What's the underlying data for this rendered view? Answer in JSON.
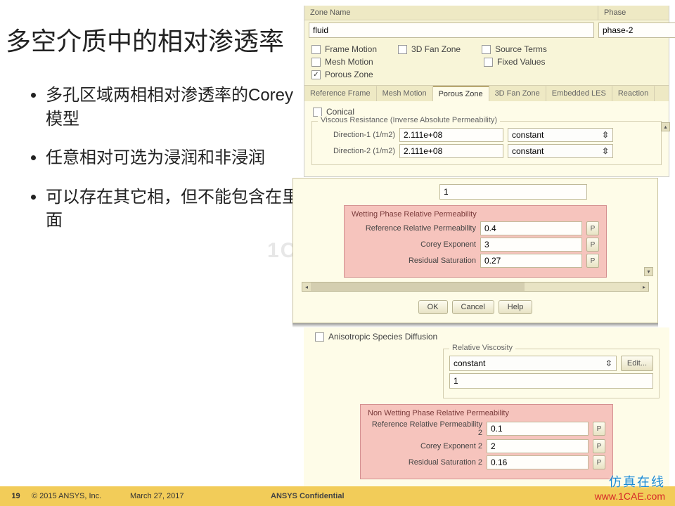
{
  "slide": {
    "title": "多空介质中的相对渗透率",
    "bullets": [
      "多孔区域两相相对渗透率的Corey 模型",
      "任意相对可选为浸润和非浸润",
      "可以存在其它相，但不能包含在里面"
    ]
  },
  "panel": {
    "zoneNameLabel": "Zone Name",
    "phaseLabel": "Phase",
    "zoneName": "fluid",
    "phase": "phase-2",
    "checks": {
      "frameMotion": "Frame Motion",
      "fan3d": "3D Fan Zone",
      "sourceTerms": "Source Terms",
      "meshMotion": "Mesh Motion",
      "fixedValues": "Fixed Values",
      "porousZone": "Porous Zone",
      "porousChecked": "✓"
    },
    "tabs": {
      "refFrame": "Reference Frame",
      "meshMotion": "Mesh Motion",
      "porousZone": "Porous Zone",
      "fan3d": "3D Fan Zone",
      "embedded": "Embedded LES",
      "reaction": "Reaction"
    },
    "conical": "Conical",
    "viscousTitle": "Viscous Resistance (Inverse Absolute Permeability)",
    "dir1Label": "Direction-1 (1/m2)",
    "dir2Label": "Direction-2 (1/m2)",
    "dirValue": "2.111e+08",
    "constant": "constant",
    "loneVal": "1"
  },
  "wetting": {
    "title": "Wetting Phase Relative Permeability",
    "refLabel": "Reference Relative Permeability",
    "refVal": "0.4",
    "coreyLabel": "Corey Exponent",
    "coreyVal": "3",
    "resLabel": "Residual Saturation",
    "resVal": "0.27",
    "pBtn": "P"
  },
  "btns": {
    "ok": "OK",
    "cancel": "Cancel",
    "help": "Help"
  },
  "lower": {
    "anisotropic": "Anisotropic Species Diffusion",
    "relViscTitle": "Relative Viscosity",
    "constant": "constant",
    "edit": "Edit...",
    "val1": "1"
  },
  "nonwet": {
    "title": "Non Wetting Phase Relative Permeability",
    "refLabel": "Reference Relative Permeability 2",
    "refVal": "0.1",
    "coreyLabel": "Corey Exponent 2",
    "coreyVal": "2",
    "resLabel": "Residual Saturation 2",
    "resVal": "0.16",
    "pBtn": "P"
  },
  "footer": {
    "page": "19",
    "copyright": "© 2015 ANSYS, Inc.",
    "date": "March 27, 2017",
    "confidential": "ANSYS Confidential"
  },
  "watermark": {
    "top": "仿真在线",
    "url": "www.1CAE.com",
    "bg": "1CAE.COM"
  }
}
